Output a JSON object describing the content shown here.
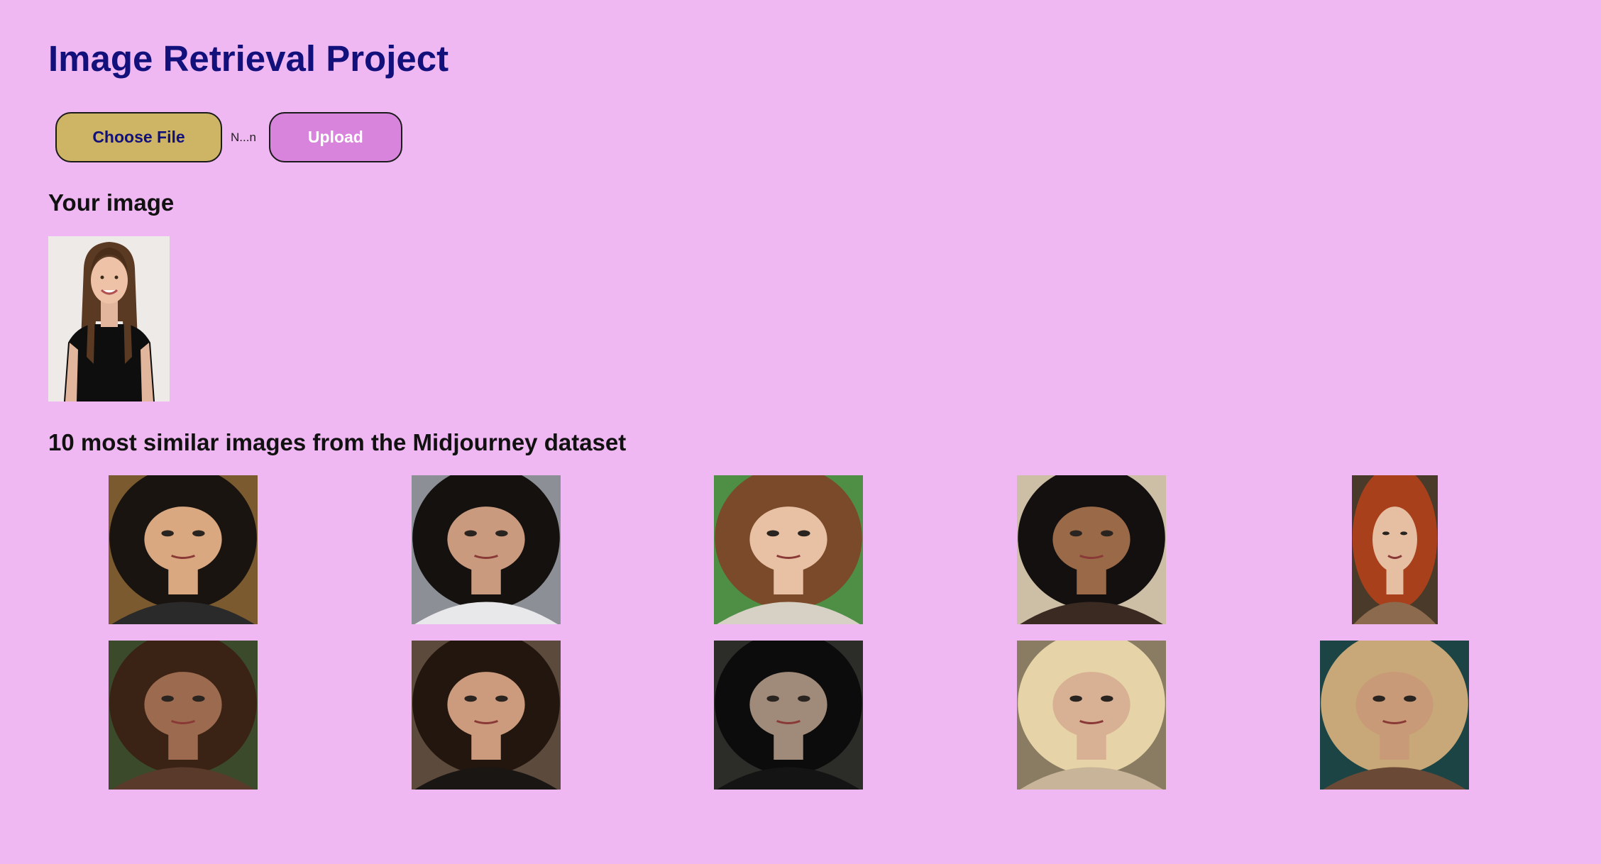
{
  "page": {
    "title": "Image Retrieval Project"
  },
  "form": {
    "choose_label": "Choose File",
    "file_name": "N...n",
    "upload_label": "Upload"
  },
  "query": {
    "heading": "Your image",
    "image_icon": "portrait-photo"
  },
  "results": {
    "heading": "10 most similar images from the Midjourney dataset",
    "images": [
      {
        "bg": "#7a5a2e",
        "hair": "#1a1410",
        "skin": "#d9a881",
        "clothes": "#2a2a2a"
      },
      {
        "bg": "#8c9096",
        "hair": "#15110f",
        "skin": "#c99a7e",
        "clothes": "#e8e8ea"
      },
      {
        "bg": "#4e8f45",
        "hair": "#7a4a2a",
        "skin": "#e8c0a3",
        "clothes": "#d7d0c4"
      },
      {
        "bg": "#cdbfa6",
        "hair": "#141010",
        "skin": "#9a6a48",
        "clothes": "#3a2a22"
      },
      {
        "bg": "#4a3a2a",
        "hair": "#a8401c",
        "skin": "#e6bfa3",
        "clothes": "#8c6a4e"
      },
      {
        "bg": "#3a4a2a",
        "hair": "#3a2214",
        "skin": "#9c6a4e",
        "clothes": "#5a3a2a"
      },
      {
        "bg": "#5c4a3c",
        "hair": "#22160e",
        "skin": "#cc9a7c",
        "clothes": "#1a1614"
      },
      {
        "bg": "#2c2c28",
        "hair": "#0c0c0c",
        "skin": "#a08a7a",
        "clothes": "#141414"
      },
      {
        "bg": "#8a7c62",
        "hair": "#e6d4a8",
        "skin": "#d8b094",
        "clothes": "#c8b498"
      },
      {
        "bg": "#1c4444",
        "hair": "#c8a878",
        "skin": "#c89a78",
        "clothes": "#6a4a36"
      }
    ]
  },
  "colors": {
    "background": "#f0b8f2",
    "title": "#12107a",
    "choose_button": "#cdb565",
    "upload_button": "#d884dc"
  }
}
